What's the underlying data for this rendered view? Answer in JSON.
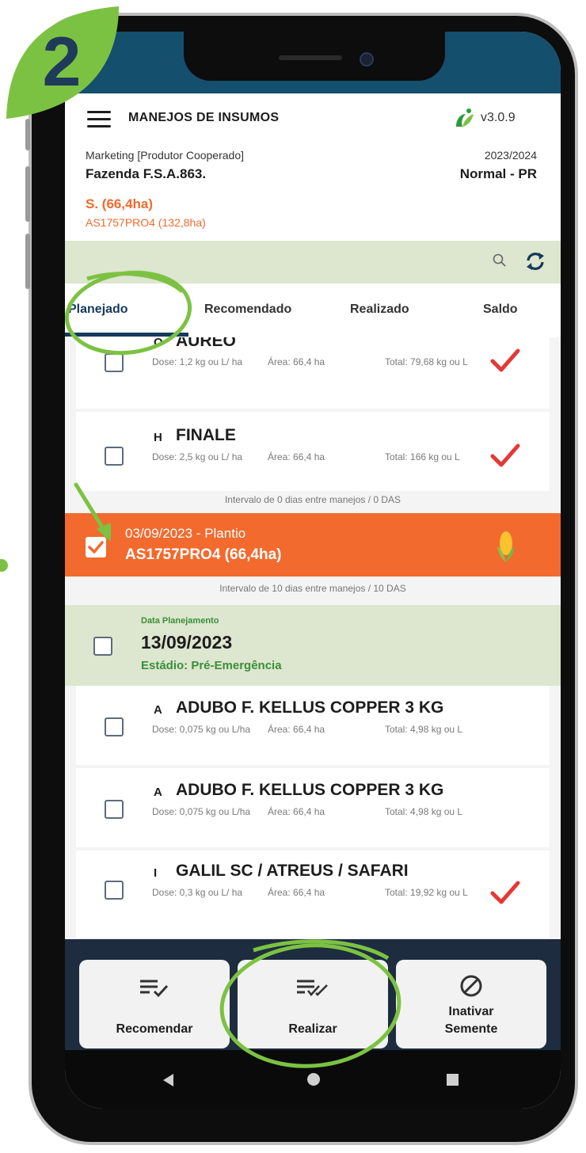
{
  "step_badge": "2",
  "header": {
    "title": "MANEJOS DE INSUMOS",
    "version": "v3.0.9",
    "profile": "Marketing [Produtor Cooperado]",
    "farm": "Fazenda F.S.A.863.",
    "season": "2023/2024",
    "region": "Normal - PR",
    "crop": "S. (66,4ha)",
    "variety": "AS1757PRO4 (132,8ha)"
  },
  "tabs": [
    "Planejado",
    "Recomendado",
    "Realizado",
    "Saldo"
  ],
  "items_top": [
    {
      "letter": "O",
      "name": "AUREO",
      "dose": "Dose: 1,2 kg ou L/ ha",
      "area": "Área: 66,4 ha",
      "total": "Total: 79,68 kg ou L",
      "checked": true
    },
    {
      "letter": "H",
      "name": "FINALE",
      "dose": "Dose: 2,5 kg ou L/ ha",
      "area": "Área: 66,4 ha",
      "total": "Total: 166 kg ou L",
      "checked": true
    }
  ],
  "interval_1": "Intervalo de 0 dias entre manejos / 0 DAS",
  "planting": {
    "date": "03/09/2023 - Plantio",
    "seed": "AS1757PRO4 (66,4ha)"
  },
  "interval_2": "Intervalo de 10 dias entre manejos / 10 DAS",
  "plan": {
    "label": "Data Planejamento",
    "date": "13/09/2023",
    "stage": "Estádio: Pré-Emergência"
  },
  "items_bottom": [
    {
      "letter": "A",
      "name": "ADUBO F. KELLUS COPPER 3 KG",
      "dose": "Dose: 0,075 kg ou L/ha",
      "area": "Área: 66,4 ha",
      "total": "Total: 4,98 kg ou L",
      "checked": false
    },
    {
      "letter": "A",
      "name": "ADUBO F. KELLUS COPPER 3 KG",
      "dose": "Dose: 0,075 kg ou L/ha",
      "area": "Área: 66,4 ha",
      "total": "Total: 4,98 kg ou L",
      "checked": false
    },
    {
      "letter": "I",
      "name": "GALIL SC / ATREUS / SAFARI",
      "dose": "Dose: 0,3 kg ou L/ ha",
      "area": "Área: 66,4 ha",
      "total": "Total: 19,92 kg ou L",
      "checked": true
    }
  ],
  "actions": {
    "recommend": "Recomendar",
    "realize": "Realizar",
    "inactivate_line1": "Inativar",
    "inactivate_line2": "Semente"
  },
  "colors": {
    "header_blue": "#144f6e",
    "orange": "#f26a2e",
    "green_highlight": "#7cc242",
    "light_green": "#dde6cf",
    "check_red": "#e53935"
  }
}
